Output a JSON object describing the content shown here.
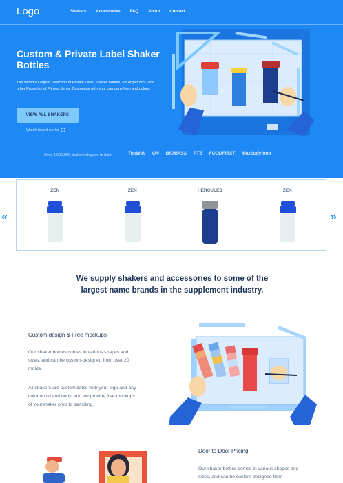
{
  "nav": {
    "logo": "Logo",
    "links": [
      "Shakers",
      "Accessories",
      "FAQ",
      "About",
      "Contact"
    ]
  },
  "hero": {
    "title": "Custom & Private Label Shaker Bottles",
    "description": "The World's Largest Selection of Private Label Shaker Bottles, Pill organizers, and other Promotional Fitness items. Customize with your company logo and colors.",
    "cta_label": "VIEW ALL SHAKERS",
    "watch_label": "Watch how it works",
    "shipped_text": "Over 3,000,000 shakers shipped to date.",
    "brands": [
      "TopWell",
      "ON",
      "BIOMASS",
      "PTS",
      "FOODFIRST",
      "Maxbodyfood"
    ],
    "colors": {
      "background": "#1e88f5",
      "cta": "#7ec9ff"
    }
  },
  "products": {
    "prev_label": "«",
    "next_label": "»",
    "items": [
      {
        "name": "ZEN",
        "lid_color": "#1f4fd6",
        "body_color": "#e6eef0"
      },
      {
        "name": "ZEN",
        "lid_color": "#1f4fd6",
        "body_color": "#e6eef0"
      },
      {
        "name": "HERCULES",
        "lid_color": "#8f959b",
        "body_color": "#1d3d8f"
      },
      {
        "name": "ZEN",
        "lid_color": "#1f4fd6",
        "body_color": "#e6eef0"
      }
    ]
  },
  "supply_text": "We supply shakers and accessories to some of the largest name brands in the supplement industry.",
  "features": [
    {
      "title": "Custom design & Free mockups",
      "paragraphs": [
        "Our shaker bottles comes in various shapes and sizes, and can be custom-designed from over 20 molds.",
        "All shakers are customizable with your logo and any color on lid and body, and we provide free mockups of yourshaker prior to sampling."
      ]
    },
    {
      "title": "Door to Door Pricing",
      "paragraphs": [
        "Our shaker bottles comes in various shapes and sizes, and can be custom-designed from"
      ]
    }
  ]
}
